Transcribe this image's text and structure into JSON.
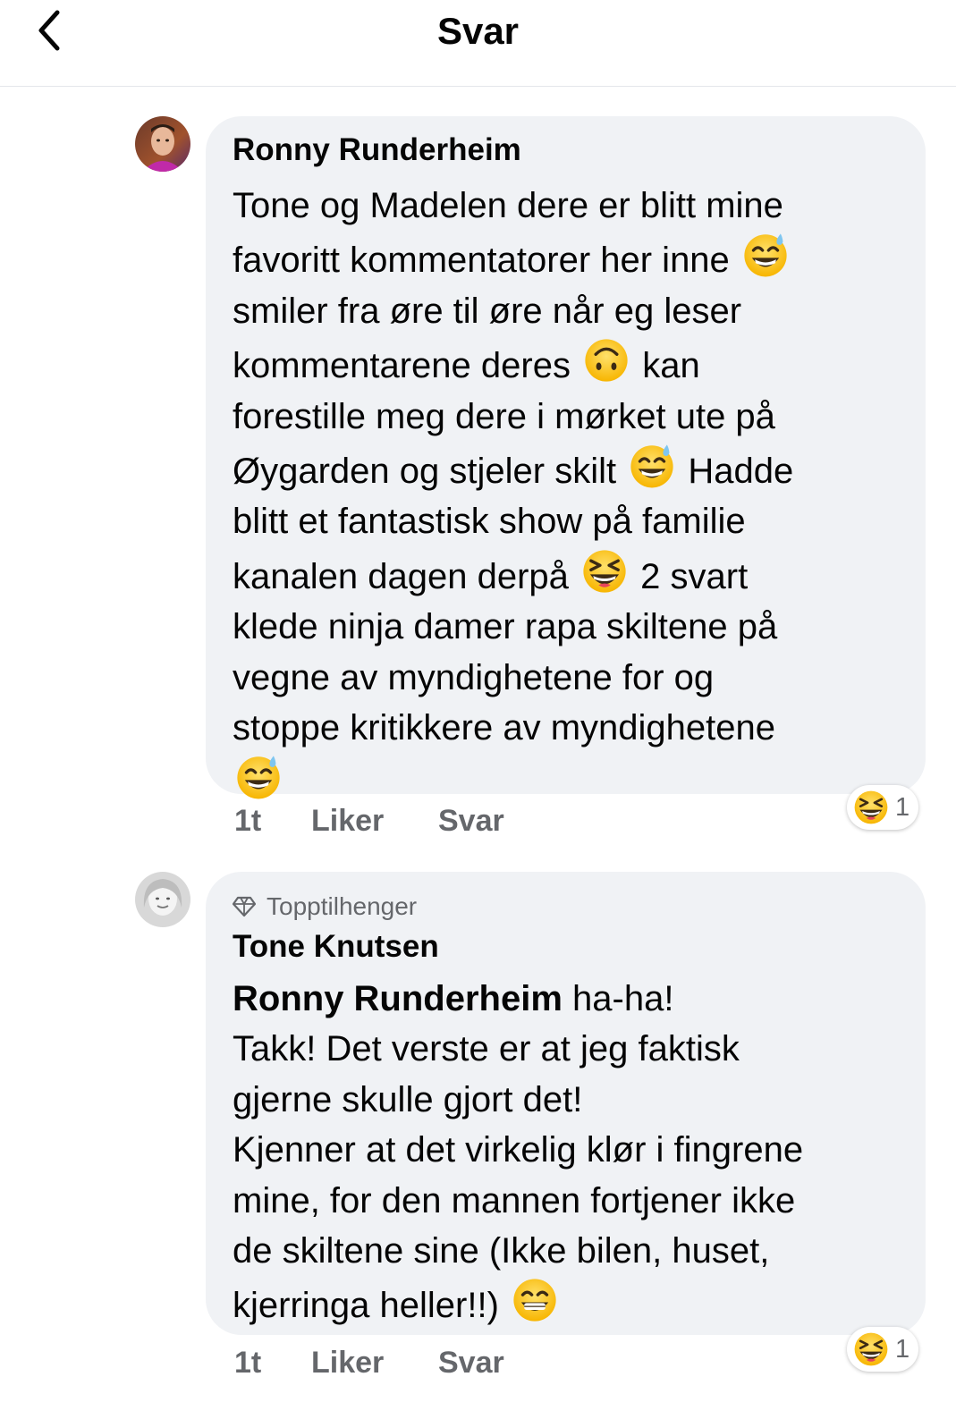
{
  "header": {
    "title": "Svar",
    "back_icon": "chevron-left-icon"
  },
  "comments": [
    {
      "author": "Ronny Runderheim",
      "lines": [
        "Tone og Madelen dere er blitt mine",
        "favoritt kommentatorer her inne",
        "smiler fra øre til øre når eg leser",
        "kommentarene deres",
        "kan",
        "forestille meg dere i mørket ute på",
        "Øygarden og stjeler skilt",
        "Hadde",
        "blitt et fantastisk show på familie",
        "kanalen dagen derpå",
        "2 svart",
        "klede ninja damer rapa skiltene på",
        "vegne av myndighetene for og",
        "stoppe kritikkere av myndighetene"
      ],
      "emojis": [
        "grinning-sweat-emoji",
        "upside-down-face-emoji",
        "grinning-sweat-emoji",
        "laughing-squint-emoji",
        "grinning-sweat-emoji"
      ],
      "time": "1t",
      "like_label": "Liker",
      "reply_label": "Svar",
      "reaction_icon": "laughing-squint-emoji",
      "reaction_count": "1"
    },
    {
      "badge": "Topptilhenger",
      "badge_icon": "diamond-icon",
      "author": "Tone Knutsen",
      "mention": "Ronny Runderheim",
      "lines": [
        "ha-ha!",
        "Takk! Det verste er at jeg faktisk",
        "gjerne skulle gjort det!",
        "Kjenner at det virkelig klør i fingrene",
        "mine, for den mannen fortjener ikke",
        "de skiltene sine (Ikke bilen, huset,",
        "kjerringa heller!!)"
      ],
      "emojis": [
        "beaming-face-emoji"
      ],
      "time": "1t",
      "like_label": "Liker",
      "reply_label": "Svar",
      "reaction_icon": "laughing-squint-emoji",
      "reaction_count": "1"
    }
  ],
  "colors": {
    "bubble": "#f0f2f5",
    "secondary_text": "#65676b",
    "primary_text": "#050505",
    "emoji_yellow": "#ffcc4d"
  }
}
